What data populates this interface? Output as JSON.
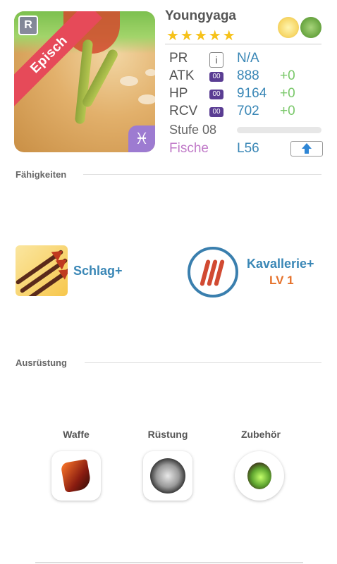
{
  "card": {
    "rarity_letter": "R",
    "rarity_label": "Episch",
    "zodiac_icon": "pisces-icon",
    "zodiac_symbol": "♓"
  },
  "monster": {
    "name": "Youngyaga",
    "stars": "★★★★★",
    "elements": [
      "light-element-icon",
      "wood-element-icon"
    ]
  },
  "stats": {
    "pr": {
      "label": "PR",
      "value": "N/A"
    },
    "atk": {
      "label": "ATK",
      "badge": "00",
      "value": "888",
      "plus": "+0"
    },
    "hp": {
      "label": "HP",
      "badge": "00",
      "value": "9164",
      "plus": "+0"
    },
    "rcv": {
      "label": "RCV",
      "badge": "00",
      "value": "702",
      "plus": "+0"
    },
    "level": {
      "label": "Stufe 08",
      "progress": 0
    },
    "type": {
      "label": "Fische",
      "value": "L56"
    }
  },
  "sections": {
    "skills": "Fähigkeiten",
    "equipment": "Ausrüstung"
  },
  "skills": {
    "active": {
      "name": "Schlag+"
    },
    "leader": {
      "name": "Kavallerie+",
      "level": "LV 1"
    }
  },
  "equipment": {
    "weapon": "Waffe",
    "armor": "Rüstung",
    "accessory": "Zubehör"
  },
  "colors": {
    "accent_blue": "#3a87b6",
    "ribbon_red": "#e64a59",
    "plus_green": "#7ac86a",
    "level_orange": "#e5712a",
    "type_purple": "#c07ac8"
  }
}
